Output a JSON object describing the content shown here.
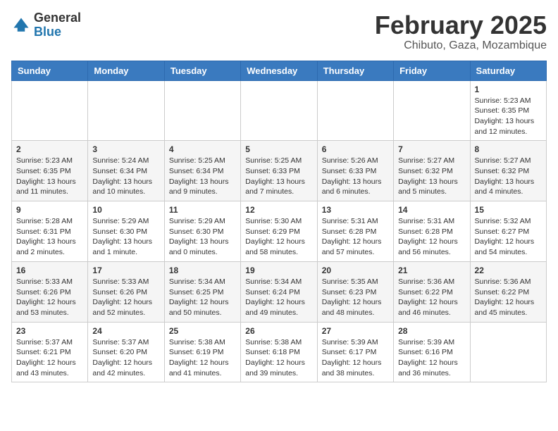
{
  "header": {
    "logo_general": "General",
    "logo_blue": "Blue",
    "month_title": "February 2025",
    "location": "Chibuto, Gaza, Mozambique"
  },
  "weekdays": [
    "Sunday",
    "Monday",
    "Tuesday",
    "Wednesday",
    "Thursday",
    "Friday",
    "Saturday"
  ],
  "weeks": [
    [
      null,
      null,
      null,
      null,
      null,
      null,
      {
        "day": "1",
        "sunrise": "5:23 AM",
        "sunset": "6:35 PM",
        "daylight": "13 hours and 12 minutes."
      }
    ],
    [
      {
        "day": "2",
        "sunrise": "5:23 AM",
        "sunset": "6:35 PM",
        "daylight": "13 hours and 11 minutes."
      },
      {
        "day": "3",
        "sunrise": "5:24 AM",
        "sunset": "6:34 PM",
        "daylight": "13 hours and 10 minutes."
      },
      {
        "day": "4",
        "sunrise": "5:25 AM",
        "sunset": "6:34 PM",
        "daylight": "13 hours and 9 minutes."
      },
      {
        "day": "5",
        "sunrise": "5:25 AM",
        "sunset": "6:33 PM",
        "daylight": "13 hours and 7 minutes."
      },
      {
        "day": "6",
        "sunrise": "5:26 AM",
        "sunset": "6:33 PM",
        "daylight": "13 hours and 6 minutes."
      },
      {
        "day": "7",
        "sunrise": "5:27 AM",
        "sunset": "6:32 PM",
        "daylight": "13 hours and 5 minutes."
      },
      {
        "day": "8",
        "sunrise": "5:27 AM",
        "sunset": "6:32 PM",
        "daylight": "13 hours and 4 minutes."
      }
    ],
    [
      {
        "day": "9",
        "sunrise": "5:28 AM",
        "sunset": "6:31 PM",
        "daylight": "13 hours and 2 minutes."
      },
      {
        "day": "10",
        "sunrise": "5:29 AM",
        "sunset": "6:30 PM",
        "daylight": "13 hours and 1 minute."
      },
      {
        "day": "11",
        "sunrise": "5:29 AM",
        "sunset": "6:30 PM",
        "daylight": "13 hours and 0 minutes."
      },
      {
        "day": "12",
        "sunrise": "5:30 AM",
        "sunset": "6:29 PM",
        "daylight": "12 hours and 58 minutes."
      },
      {
        "day": "13",
        "sunrise": "5:31 AM",
        "sunset": "6:28 PM",
        "daylight": "12 hours and 57 minutes."
      },
      {
        "day": "14",
        "sunrise": "5:31 AM",
        "sunset": "6:28 PM",
        "daylight": "12 hours and 56 minutes."
      },
      {
        "day": "15",
        "sunrise": "5:32 AM",
        "sunset": "6:27 PM",
        "daylight": "12 hours and 54 minutes."
      }
    ],
    [
      {
        "day": "16",
        "sunrise": "5:33 AM",
        "sunset": "6:26 PM",
        "daylight": "12 hours and 53 minutes."
      },
      {
        "day": "17",
        "sunrise": "5:33 AM",
        "sunset": "6:26 PM",
        "daylight": "12 hours and 52 minutes."
      },
      {
        "day": "18",
        "sunrise": "5:34 AM",
        "sunset": "6:25 PM",
        "daylight": "12 hours and 50 minutes."
      },
      {
        "day": "19",
        "sunrise": "5:34 AM",
        "sunset": "6:24 PM",
        "daylight": "12 hours and 49 minutes."
      },
      {
        "day": "20",
        "sunrise": "5:35 AM",
        "sunset": "6:23 PM",
        "daylight": "12 hours and 48 minutes."
      },
      {
        "day": "21",
        "sunrise": "5:36 AM",
        "sunset": "6:22 PM",
        "daylight": "12 hours and 46 minutes."
      },
      {
        "day": "22",
        "sunrise": "5:36 AM",
        "sunset": "6:22 PM",
        "daylight": "12 hours and 45 minutes."
      }
    ],
    [
      {
        "day": "23",
        "sunrise": "5:37 AM",
        "sunset": "6:21 PM",
        "daylight": "12 hours and 43 minutes."
      },
      {
        "day": "24",
        "sunrise": "5:37 AM",
        "sunset": "6:20 PM",
        "daylight": "12 hours and 42 minutes."
      },
      {
        "day": "25",
        "sunrise": "5:38 AM",
        "sunset": "6:19 PM",
        "daylight": "12 hours and 41 minutes."
      },
      {
        "day": "26",
        "sunrise": "5:38 AM",
        "sunset": "6:18 PM",
        "daylight": "12 hours and 39 minutes."
      },
      {
        "day": "27",
        "sunrise": "5:39 AM",
        "sunset": "6:17 PM",
        "daylight": "12 hours and 38 minutes."
      },
      {
        "day": "28",
        "sunrise": "5:39 AM",
        "sunset": "6:16 PM",
        "daylight": "12 hours and 36 minutes."
      },
      null
    ]
  ]
}
